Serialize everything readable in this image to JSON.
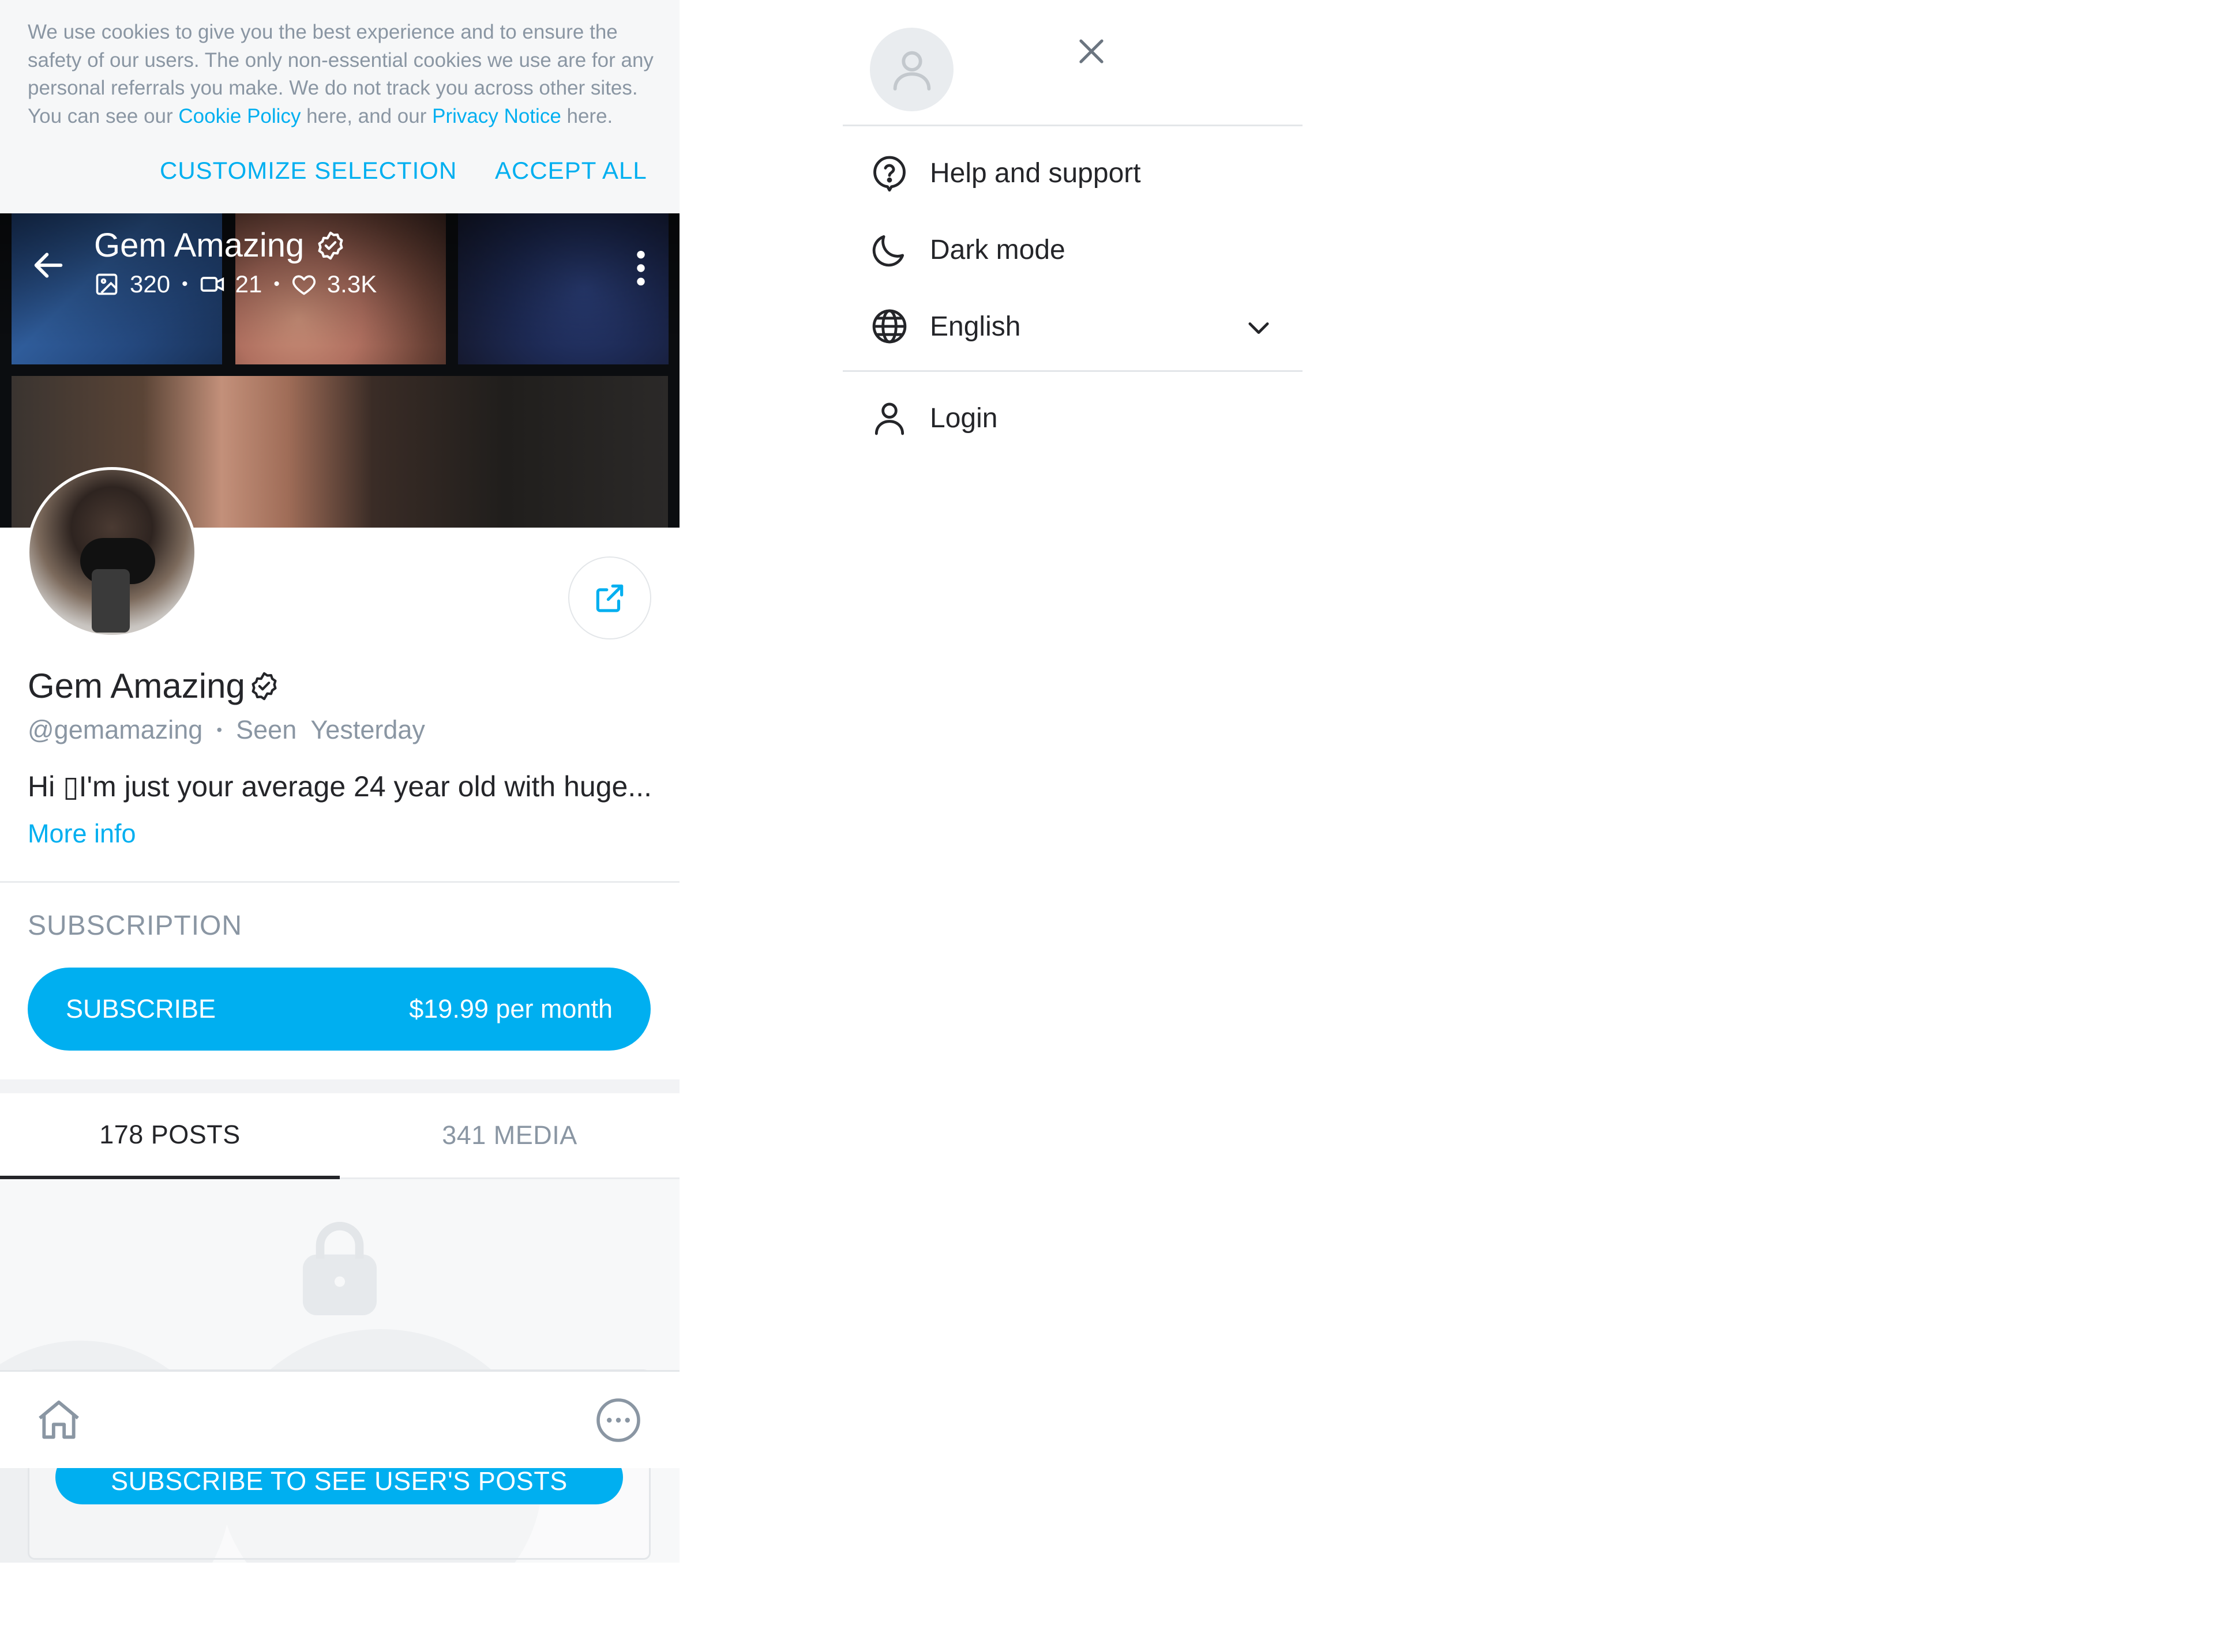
{
  "cookie_banner": {
    "text_part1": "We use cookies to give you the best experience and to ensure the safety of our users. The only non-essential cookies we use are for any personal referrals you make. We do not track you across other sites. You can see our ",
    "cookie_policy_link": "Cookie Policy",
    "text_part2": " here, and our ",
    "privacy_notice_link": "Privacy Notice",
    "text_part3": " here.",
    "customize_label": "CUSTOMIZE SELECTION",
    "accept_label": "ACCEPT ALL"
  },
  "cover": {
    "name": "Gem Amazing",
    "photos_count": "320",
    "videos_count": "21",
    "likes_count": "3.3K",
    "separator": "•"
  },
  "profile": {
    "name": "Gem Amazing",
    "handle": "@gemamazing",
    "separator": "•",
    "seen_text": "Seen  Yesterday",
    "bio": "Hi ▯I'm just your average 24 year old with huge...",
    "more_info_label": "More info"
  },
  "subscription": {
    "section_label": "SUBSCRIPTION",
    "button_label": "SUBSCRIBE",
    "price_label": "$19.99 per month"
  },
  "tabs": [
    {
      "label": "178 POSTS",
      "active": true
    },
    {
      "label": "341 MEDIA",
      "active": false
    }
  ],
  "locked": {
    "button_label": "SUBSCRIBE TO SEE USER'S POSTS"
  },
  "bottom_nav": {
    "icons": [
      "home-icon",
      "more-circle-icon"
    ]
  },
  "menu": {
    "items": [
      {
        "label": "Help and support",
        "icon": "help-question-icon"
      },
      {
        "label": "Dark mode",
        "icon": "moon-icon"
      },
      {
        "label": "English",
        "icon": "globe-icon"
      },
      {
        "label": "Login",
        "icon": "user-icon"
      }
    ]
  },
  "colors": {
    "accent": "#00aff0",
    "text_primary": "#242529",
    "text_secondary": "#8a96a3",
    "banner_bg": "#f6f7f8",
    "divider": "#e9ebee"
  }
}
